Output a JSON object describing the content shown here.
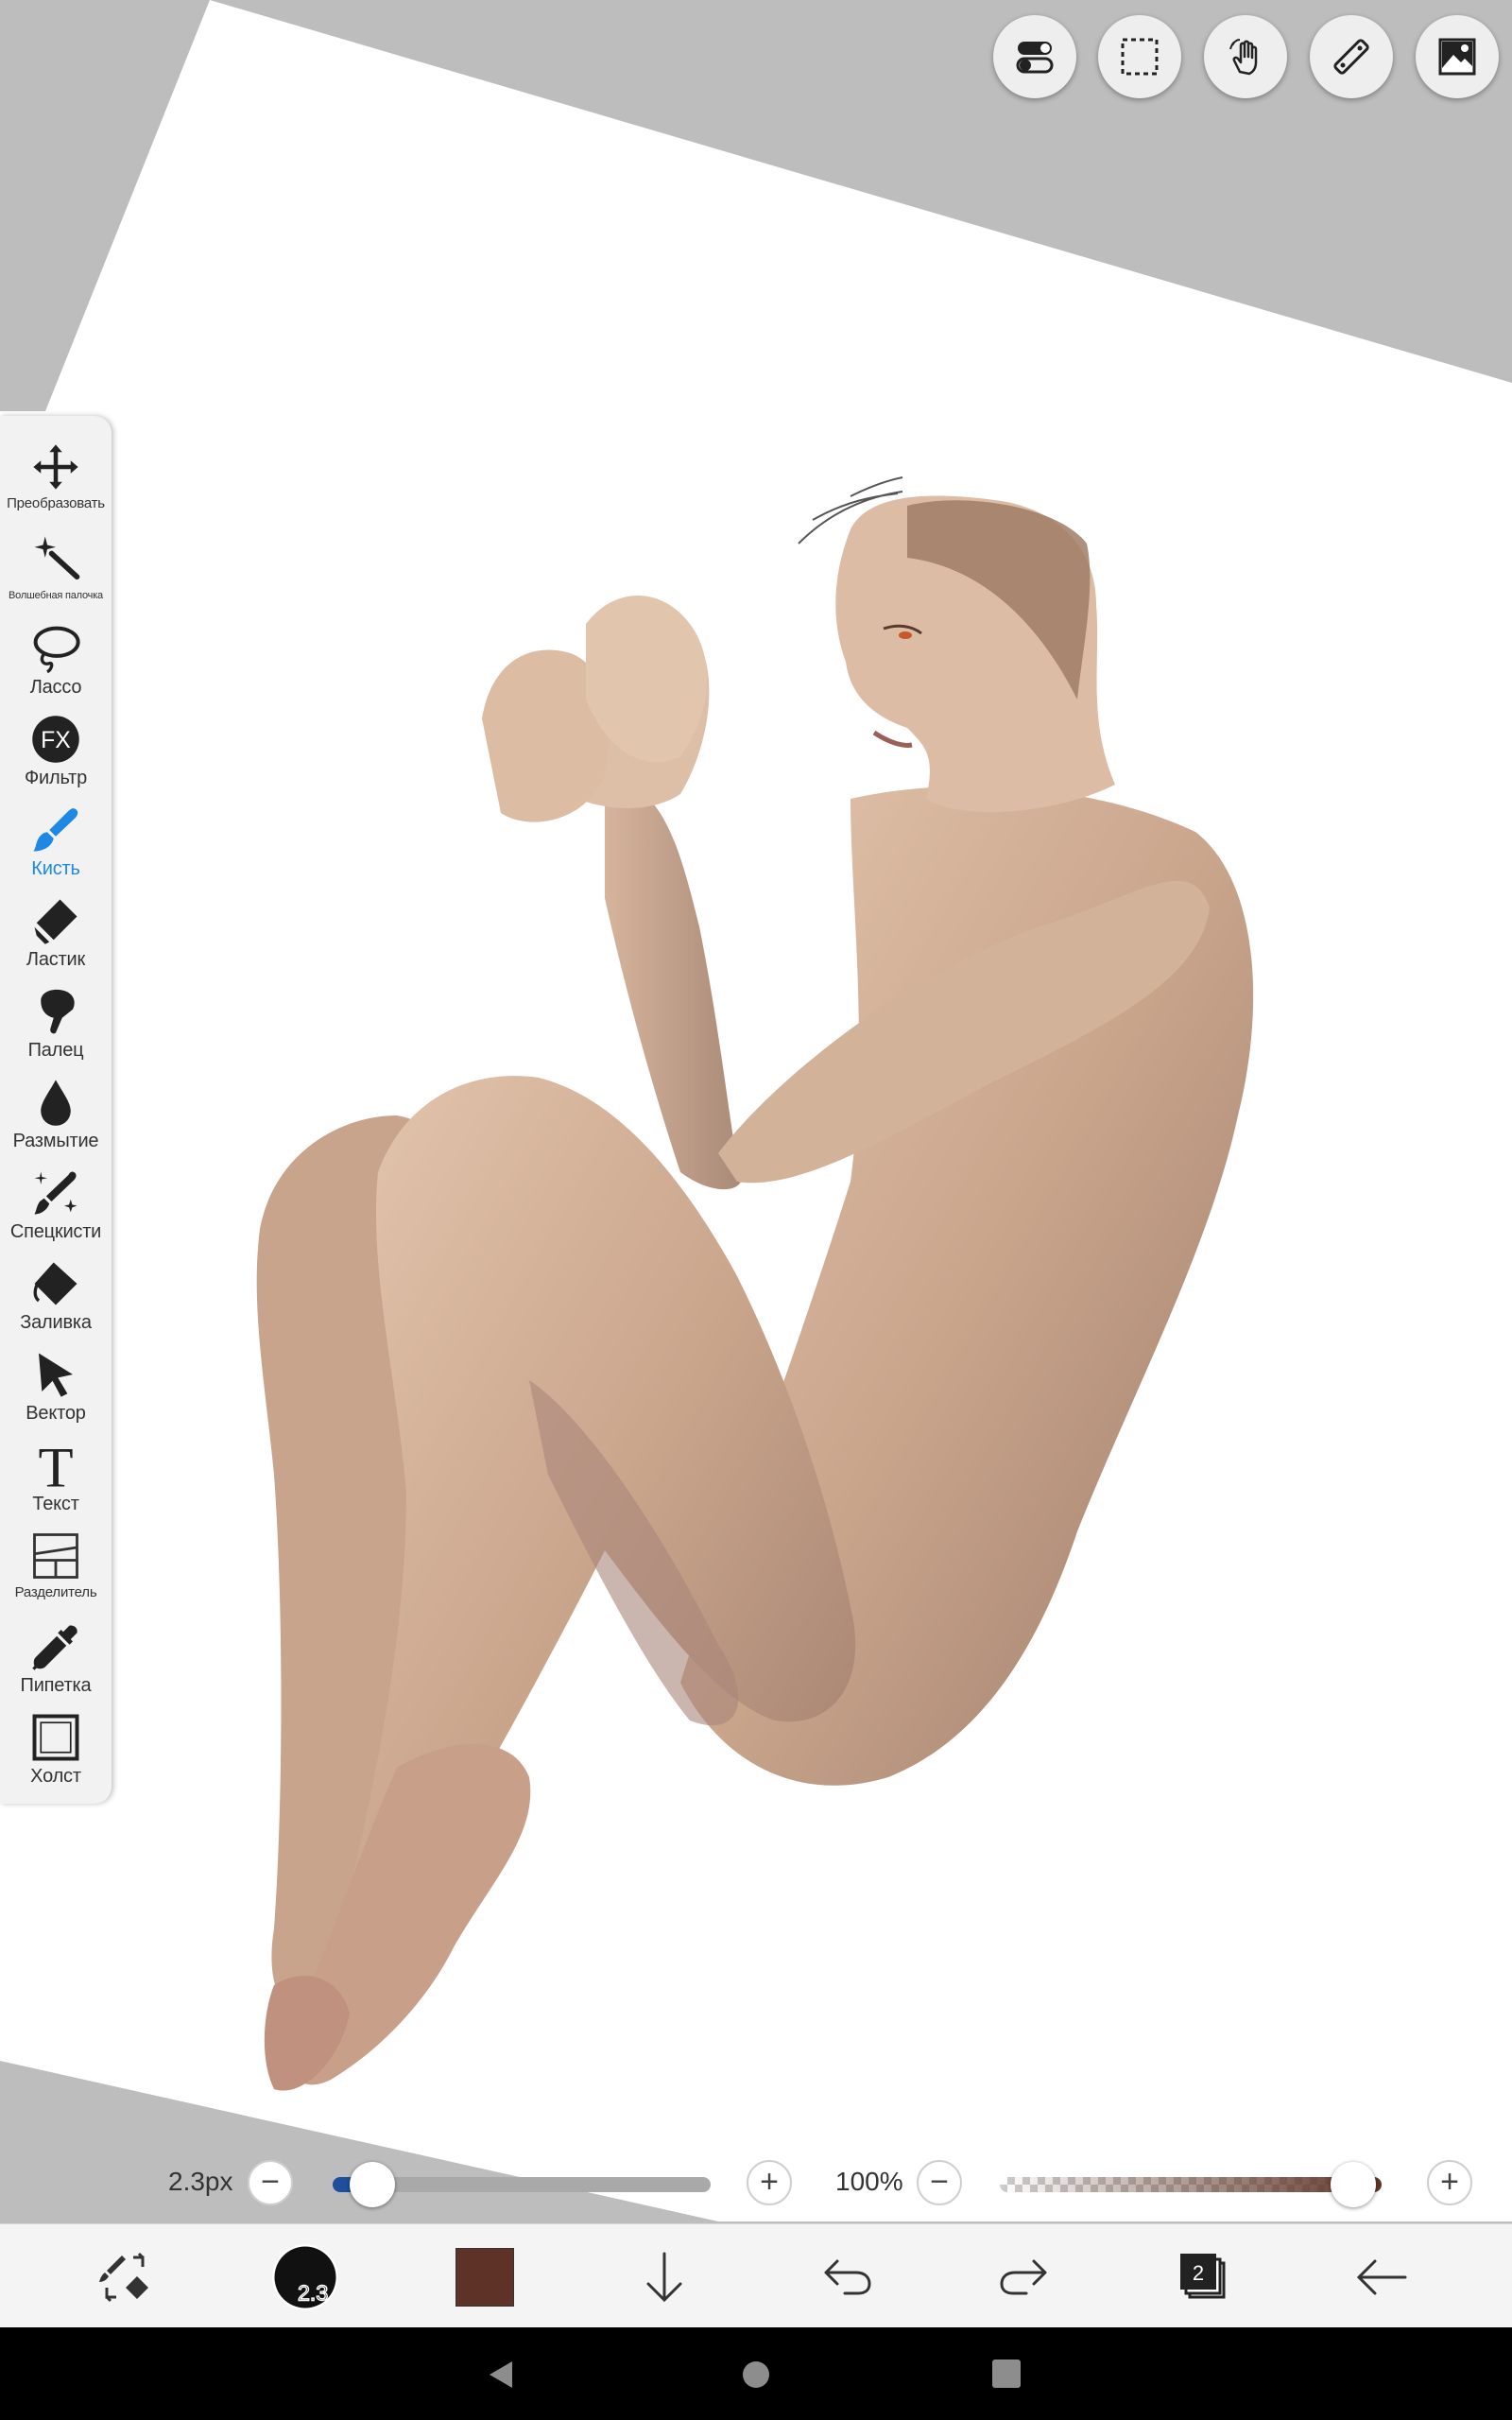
{
  "tools": [
    {
      "id": "transform",
      "label": "Преобразовать",
      "icon": "move-arrows-icon"
    },
    {
      "id": "magic-wand",
      "label": "Волшебная палочка",
      "icon": "magic-wand-icon"
    },
    {
      "id": "lasso",
      "label": "Лассо",
      "icon": "lasso-icon"
    },
    {
      "id": "filter",
      "label": "Фильтр",
      "icon": "fx-icon"
    },
    {
      "id": "brush",
      "label": "Кисть",
      "icon": "brush-icon",
      "active": true
    },
    {
      "id": "eraser",
      "label": "Ластик",
      "icon": "eraser-icon"
    },
    {
      "id": "smudge",
      "label": "Палец",
      "icon": "smudge-finger-icon"
    },
    {
      "id": "blur",
      "label": "Размытие",
      "icon": "blur-drop-icon"
    },
    {
      "id": "special-brush",
      "label": "Спецкисти",
      "icon": "special-brush-icon"
    },
    {
      "id": "fill",
      "label": "Заливка",
      "icon": "fill-bucket-icon"
    },
    {
      "id": "vector",
      "label": "Вектор",
      "icon": "vector-cursor-icon"
    },
    {
      "id": "text",
      "label": "Текст",
      "icon": "text-icon"
    },
    {
      "id": "divider",
      "label": "Разделитель",
      "icon": "frame-divider-icon"
    },
    {
      "id": "eyedropper",
      "label": "Пипетка",
      "icon": "eyedropper-icon"
    },
    {
      "id": "canvas",
      "label": "Холст",
      "icon": "canvas-icon"
    }
  ],
  "fx_glyph": "FX",
  "text_glyph": "T",
  "top_toolbar": [
    {
      "id": "toggle",
      "icon": "toggle-switches-icon"
    },
    {
      "id": "selection",
      "icon": "dashed-selection-icon"
    },
    {
      "id": "gesture",
      "icon": "hand-gesture-icon"
    },
    {
      "id": "ruler",
      "icon": "ruler-icon"
    },
    {
      "id": "material",
      "icon": "image-material-icon"
    }
  ],
  "brush_size": {
    "label": "2.3px",
    "value": 2.3,
    "fraction": 0.04
  },
  "brush_opacity": {
    "label": "100%",
    "value": 100,
    "fraction": 1.0
  },
  "current_color": "#5e3226",
  "brush_preview_label": "2.3",
  "layers_count": "2",
  "minus_glyph": "−",
  "plus_glyph": "+"
}
